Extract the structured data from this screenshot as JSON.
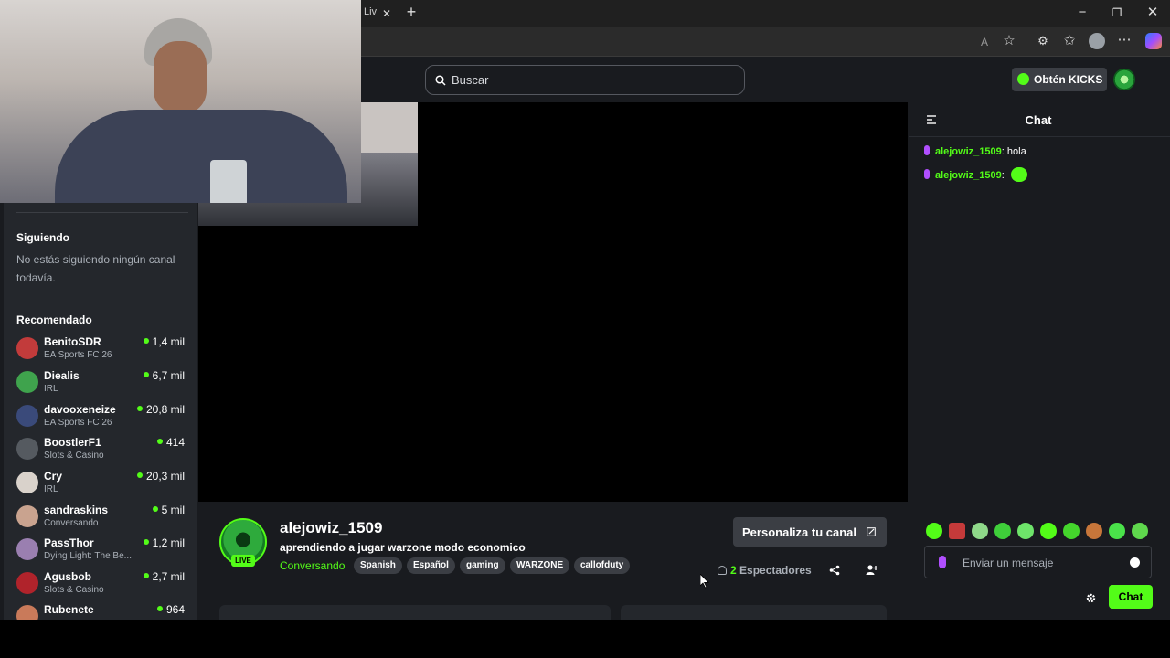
{
  "browser": {
    "tab_title": "Liv",
    "new_tab": "+",
    "window_buttons": [
      "minimize",
      "restore",
      "close"
    ],
    "toolbar_icons": [
      "read-aloud-icon",
      "favorite-star-icon",
      "extensions-icon",
      "favorites-icon",
      "profile-icon",
      "more-icon",
      "copilot-icon"
    ]
  },
  "header": {
    "search_placeholder": "Buscar",
    "kicks_button": "Obtén KICKS"
  },
  "sidebar": {
    "following_title": "Siguiendo",
    "following_empty": "No estás siguiendo ningún canal todavía.",
    "recommended_title": "Recomendado",
    "recommended": [
      {
        "name": "BenitoSDR",
        "category": "EA Sports FC 26",
        "viewers": "1,4 mil",
        "color": "#c23b3b"
      },
      {
        "name": "Diealis",
        "category": "IRL",
        "viewers": "6,7 mil",
        "color": "#3fa34d"
      },
      {
        "name": "davooxeneize",
        "category": "EA Sports FC 26",
        "viewers": "20,8 mil",
        "color": "#3a4a7a"
      },
      {
        "name": "BoostlerF1",
        "category": "Slots & Casino",
        "viewers": "414",
        "color": "#555a60"
      },
      {
        "name": "Cry",
        "category": "IRL",
        "viewers": "20,3 mil",
        "color": "#d9d2cb"
      },
      {
        "name": "sandraskins",
        "category": "Conversando",
        "viewers": "5 mil",
        "color": "#c9a38f"
      },
      {
        "name": "PassThor",
        "category": "Dying Light: The Be...",
        "viewers": "1,2 mil",
        "color": "#9a7fb0"
      },
      {
        "name": "Agusbob",
        "category": "Slots & Casino",
        "viewers": "2,7 mil",
        "color": "#b0232b"
      },
      {
        "name": "Rubenete",
        "category": "",
        "viewers": "964",
        "color": "#c97a5a"
      }
    ]
  },
  "channel": {
    "name": "alejowiz_1509",
    "live_badge": "LIVE",
    "title": "aprendiendo a jugar warzone modo economico",
    "category": "Conversando",
    "tags": [
      "Spanish",
      "Español",
      "gaming",
      "WARZONE",
      "callofduty"
    ],
    "customize_button": "Personaliza tu canal",
    "viewer_count": "2",
    "viewer_label": "Espectadores"
  },
  "chat": {
    "title": "Chat",
    "messages": [
      {
        "user": "alejowiz_1509",
        "text": "hola",
        "emote": false
      },
      {
        "user": "alejowiz_1509",
        "text": "",
        "emote": true
      }
    ],
    "input_placeholder": "Enviar un mensaje",
    "send_button": "Chat",
    "accent_color": "#53fc18"
  }
}
